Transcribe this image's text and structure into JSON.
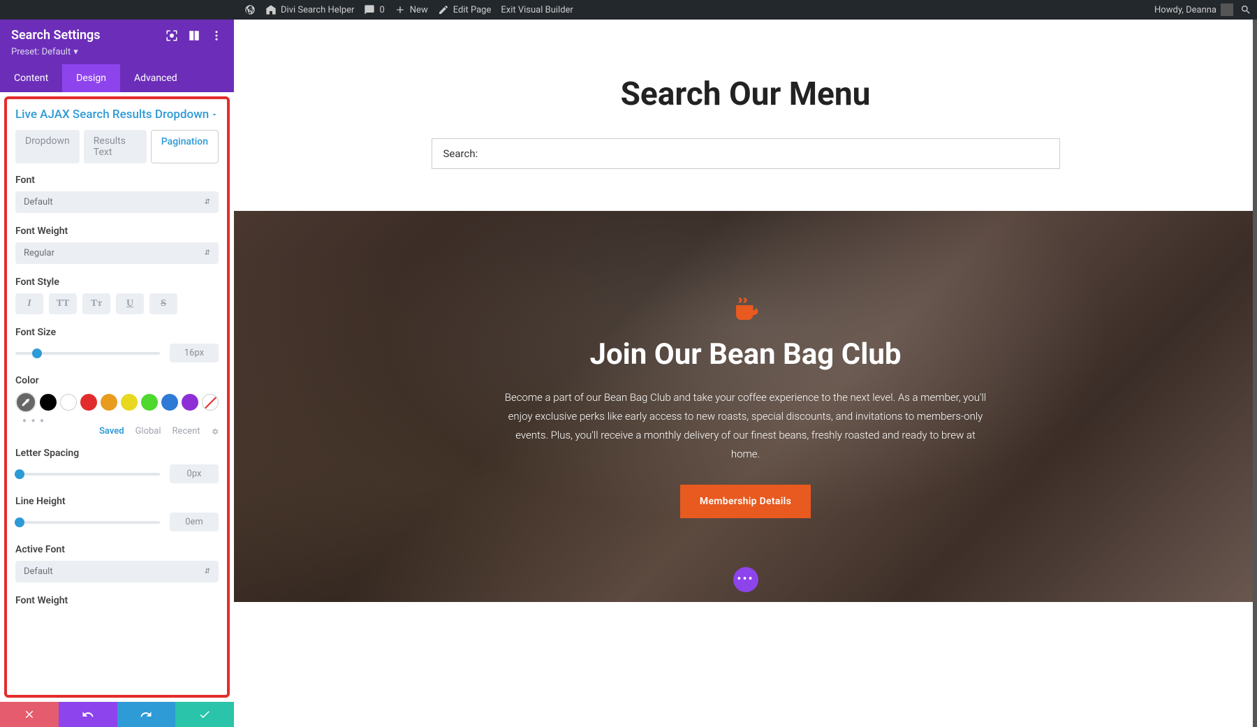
{
  "adminbar": {
    "site_name": "Divi Search Helper",
    "comments_count": "0",
    "new_label": "New",
    "edit_page": "Edit Page",
    "exit_visual_builder": "Exit Visual Builder",
    "howdy": "Howdy, Deanna"
  },
  "sidebar": {
    "title": "Search Settings",
    "preset_label": "Preset: Default",
    "tabs": {
      "content": "Content",
      "design": "Design",
      "advanced": "Advanced"
    },
    "section_title": "Live AJAX Search Results Dropdown",
    "subtabs": {
      "dropdown": "Dropdown",
      "results_text": "Results Text",
      "pagination": "Pagination"
    },
    "labels": {
      "font": "Font",
      "font_weight": "Font Weight",
      "font_style": "Font Style",
      "font_size": "Font Size",
      "color": "Color",
      "letter_spacing": "Letter Spacing",
      "line_height": "Line Height",
      "active_font": "Active Font",
      "font_weight2": "Font Weight"
    },
    "values": {
      "font": "Default",
      "font_weight": "Regular",
      "font_size": "16px",
      "letter_spacing": "0px",
      "line_height": "0em",
      "active_font": "Default"
    },
    "style_buttons": {
      "italic": "I",
      "uppercase": "TT",
      "smallcaps": "Tᴛ",
      "underline": "U",
      "strike": "S"
    },
    "palette_tabs": {
      "saved": "Saved",
      "global": "Global",
      "recent": "Recent"
    },
    "swatches": [
      "#666666",
      "#000000",
      "#ffffff",
      "#E22C2C",
      "#E89B1F",
      "#E8D81F",
      "#4FD82E",
      "#2E7AD6",
      "#8E2ED6"
    ]
  },
  "preview": {
    "hero1_title": "Search Our Menu",
    "search_label": "Search:",
    "hero2_title": "Join Our Bean Bag Club",
    "hero2_body": "Become a part of our Bean Bag Club and take your coffee experience to the next level. As a member, you'll enjoy exclusive perks like early access to new roasts, special discounts, and invitations to members-only events. Plus, you'll receive a monthly delivery of our finest beans, freshly roasted and ready to brew at home.",
    "cta_label": "Membership Details"
  }
}
